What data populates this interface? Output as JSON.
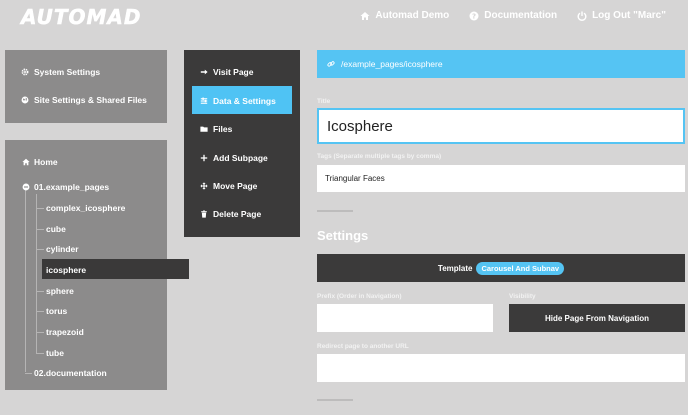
{
  "header": {
    "logo": "AUTOMAD",
    "links": [
      {
        "label": "Automad Demo",
        "icon": "home-icon"
      },
      {
        "label": "Documentation",
        "icon": "question-circle-icon"
      },
      {
        "label": "Log Out \"Marc\"",
        "icon": "power-icon"
      }
    ]
  },
  "sidebar": {
    "system_settings": "System Settings",
    "site_settings": "Site Settings & Shared Files",
    "tree": {
      "home": "Home",
      "example_pages": "01.example_pages",
      "children": [
        "complex_icosphere",
        "cube",
        "cylinder",
        "icosphere",
        "sphere",
        "torus",
        "trapezoid",
        "tube"
      ],
      "active": "icosphere",
      "documentation": "02.documentation"
    }
  },
  "actions": {
    "items": [
      {
        "label": "Visit Page",
        "icon": "arrow-right-icon"
      },
      {
        "label": "Data & Settings",
        "icon": "sliders-icon"
      },
      {
        "label": "Files",
        "icon": "folder-icon"
      },
      {
        "label": "Add Subpage",
        "icon": "plus-icon"
      },
      {
        "label": "Move Page",
        "icon": "move-icon"
      },
      {
        "label": "Delete Page",
        "icon": "trash-icon"
      }
    ],
    "active": "Data & Settings"
  },
  "main": {
    "breadcrumb": "/example_pages/icosphere",
    "title_label": "Title",
    "title_value": "Icosphere",
    "tags_label": "Tags (Separate multiple tags by comma)",
    "tags_value": "Triangular Faces",
    "settings_heading": "Settings",
    "template_label": "Template",
    "template_value": "Carousel And Subnav",
    "prefix_label": "Prefix (Order in Navigation)",
    "visibility_label": "Visibility",
    "hide_button": "Hide Page From Navigation",
    "redirect_label": "Redirect page to another URL"
  },
  "colors": {
    "accent": "#55c4f3",
    "dark": "#3b3a3a",
    "panel": "#8c8b8b",
    "background": "#d6d5d5"
  }
}
